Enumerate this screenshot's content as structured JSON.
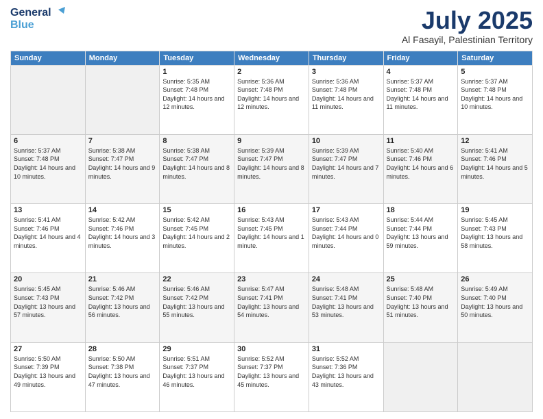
{
  "header": {
    "logo_line1": "General",
    "logo_line2": "Blue",
    "month": "July 2025",
    "location": "Al Fasayil, Palestinian Territory"
  },
  "days_of_week": [
    "Sunday",
    "Monday",
    "Tuesday",
    "Wednesday",
    "Thursday",
    "Friday",
    "Saturday"
  ],
  "weeks": [
    [
      {
        "day": "",
        "info": ""
      },
      {
        "day": "",
        "info": ""
      },
      {
        "day": "1",
        "info": "Sunrise: 5:35 AM\nSunset: 7:48 PM\nDaylight: 14 hours and 12 minutes."
      },
      {
        "day": "2",
        "info": "Sunrise: 5:36 AM\nSunset: 7:48 PM\nDaylight: 14 hours and 12 minutes."
      },
      {
        "day": "3",
        "info": "Sunrise: 5:36 AM\nSunset: 7:48 PM\nDaylight: 14 hours and 11 minutes."
      },
      {
        "day": "4",
        "info": "Sunrise: 5:37 AM\nSunset: 7:48 PM\nDaylight: 14 hours and 11 minutes."
      },
      {
        "day": "5",
        "info": "Sunrise: 5:37 AM\nSunset: 7:48 PM\nDaylight: 14 hours and 10 minutes."
      }
    ],
    [
      {
        "day": "6",
        "info": "Sunrise: 5:37 AM\nSunset: 7:48 PM\nDaylight: 14 hours and 10 minutes."
      },
      {
        "day": "7",
        "info": "Sunrise: 5:38 AM\nSunset: 7:47 PM\nDaylight: 14 hours and 9 minutes."
      },
      {
        "day": "8",
        "info": "Sunrise: 5:38 AM\nSunset: 7:47 PM\nDaylight: 14 hours and 8 minutes."
      },
      {
        "day": "9",
        "info": "Sunrise: 5:39 AM\nSunset: 7:47 PM\nDaylight: 14 hours and 8 minutes."
      },
      {
        "day": "10",
        "info": "Sunrise: 5:39 AM\nSunset: 7:47 PM\nDaylight: 14 hours and 7 minutes."
      },
      {
        "day": "11",
        "info": "Sunrise: 5:40 AM\nSunset: 7:46 PM\nDaylight: 14 hours and 6 minutes."
      },
      {
        "day": "12",
        "info": "Sunrise: 5:41 AM\nSunset: 7:46 PM\nDaylight: 14 hours and 5 minutes."
      }
    ],
    [
      {
        "day": "13",
        "info": "Sunrise: 5:41 AM\nSunset: 7:46 PM\nDaylight: 14 hours and 4 minutes."
      },
      {
        "day": "14",
        "info": "Sunrise: 5:42 AM\nSunset: 7:46 PM\nDaylight: 14 hours and 3 minutes."
      },
      {
        "day": "15",
        "info": "Sunrise: 5:42 AM\nSunset: 7:45 PM\nDaylight: 14 hours and 2 minutes."
      },
      {
        "day": "16",
        "info": "Sunrise: 5:43 AM\nSunset: 7:45 PM\nDaylight: 14 hours and 1 minute."
      },
      {
        "day": "17",
        "info": "Sunrise: 5:43 AM\nSunset: 7:44 PM\nDaylight: 14 hours and 0 minutes."
      },
      {
        "day": "18",
        "info": "Sunrise: 5:44 AM\nSunset: 7:44 PM\nDaylight: 13 hours and 59 minutes."
      },
      {
        "day": "19",
        "info": "Sunrise: 5:45 AM\nSunset: 7:43 PM\nDaylight: 13 hours and 58 minutes."
      }
    ],
    [
      {
        "day": "20",
        "info": "Sunrise: 5:45 AM\nSunset: 7:43 PM\nDaylight: 13 hours and 57 minutes."
      },
      {
        "day": "21",
        "info": "Sunrise: 5:46 AM\nSunset: 7:42 PM\nDaylight: 13 hours and 56 minutes."
      },
      {
        "day": "22",
        "info": "Sunrise: 5:46 AM\nSunset: 7:42 PM\nDaylight: 13 hours and 55 minutes."
      },
      {
        "day": "23",
        "info": "Sunrise: 5:47 AM\nSunset: 7:41 PM\nDaylight: 13 hours and 54 minutes."
      },
      {
        "day": "24",
        "info": "Sunrise: 5:48 AM\nSunset: 7:41 PM\nDaylight: 13 hours and 53 minutes."
      },
      {
        "day": "25",
        "info": "Sunrise: 5:48 AM\nSunset: 7:40 PM\nDaylight: 13 hours and 51 minutes."
      },
      {
        "day": "26",
        "info": "Sunrise: 5:49 AM\nSunset: 7:40 PM\nDaylight: 13 hours and 50 minutes."
      }
    ],
    [
      {
        "day": "27",
        "info": "Sunrise: 5:50 AM\nSunset: 7:39 PM\nDaylight: 13 hours and 49 minutes."
      },
      {
        "day": "28",
        "info": "Sunrise: 5:50 AM\nSunset: 7:38 PM\nDaylight: 13 hours and 47 minutes."
      },
      {
        "day": "29",
        "info": "Sunrise: 5:51 AM\nSunset: 7:37 PM\nDaylight: 13 hours and 46 minutes."
      },
      {
        "day": "30",
        "info": "Sunrise: 5:52 AM\nSunset: 7:37 PM\nDaylight: 13 hours and 45 minutes."
      },
      {
        "day": "31",
        "info": "Sunrise: 5:52 AM\nSunset: 7:36 PM\nDaylight: 13 hours and 43 minutes."
      },
      {
        "day": "",
        "info": ""
      },
      {
        "day": "",
        "info": ""
      }
    ]
  ]
}
